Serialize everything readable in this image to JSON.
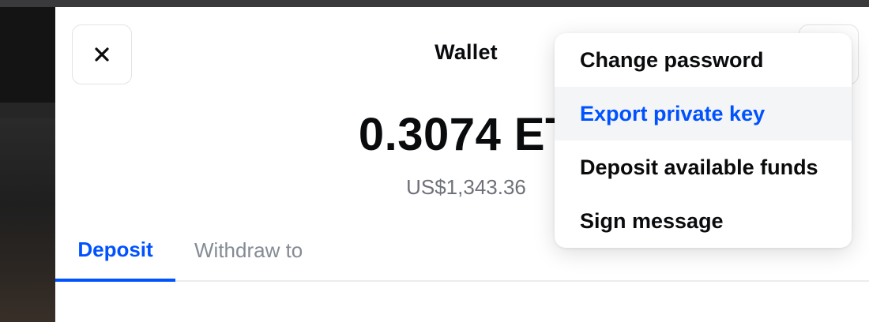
{
  "header": {
    "close_icon": "close-icon",
    "title": "Wallet"
  },
  "balance": {
    "crypto": "0.3074 ET",
    "fiat": "US$1,343.36"
  },
  "tabs": [
    {
      "label": "Deposit",
      "active": true
    },
    {
      "label": "Withdraw to",
      "active": false
    }
  ],
  "menu": {
    "items": [
      {
        "label": "Change password"
      },
      {
        "label": "Export private key",
        "highlighted": true
      },
      {
        "label": "Deposit available funds"
      },
      {
        "label": "Sign message"
      }
    ]
  },
  "colors": {
    "accent": "#0052ff",
    "text": "#0a0b0d",
    "muted": "#6e7178",
    "hover": "#f4f5f6"
  }
}
